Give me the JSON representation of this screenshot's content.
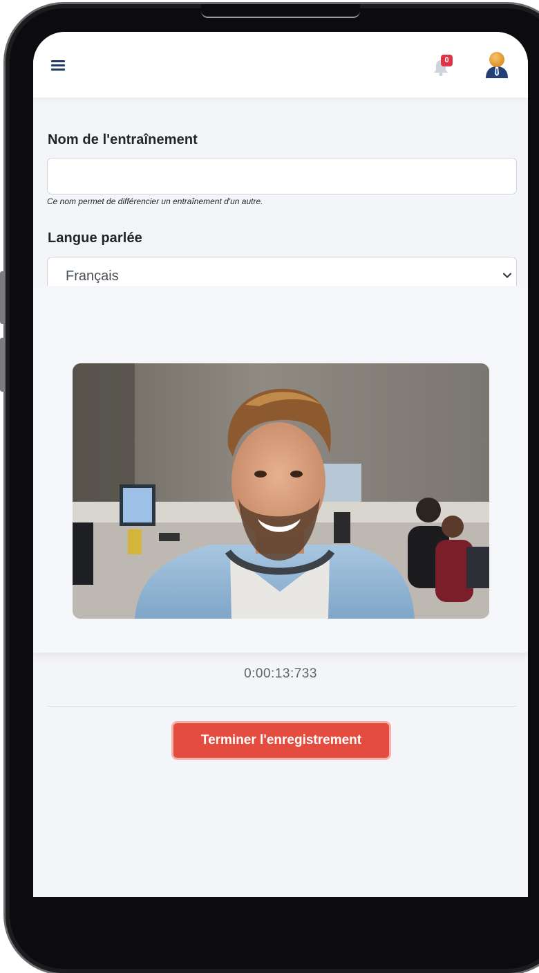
{
  "header": {
    "menu_icon": "hamburger-menu-icon",
    "notifications": {
      "icon": "bell-icon",
      "count": "0"
    },
    "profile_icon": "user-avatar-icon"
  },
  "form": {
    "name_label": "Nom de l'entraînement",
    "name_value": "",
    "name_help": "Ce nom permet de différencier un entraînement d'un autre.",
    "language_label": "Langue parlée",
    "language_selected": "Français"
  },
  "recording": {
    "video_subject": "webcam-preview",
    "timer": "0:00:13:733",
    "stop_label": "Terminer l'enregistrement"
  },
  "colors": {
    "accent": "#1f3a68",
    "danger": "#e44c3f",
    "badge": "#dc3545",
    "background": "#f4f5f9"
  }
}
